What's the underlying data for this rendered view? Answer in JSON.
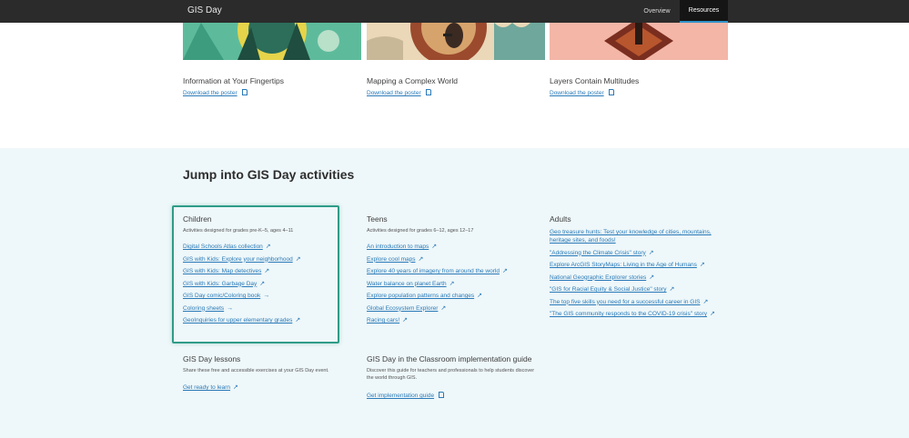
{
  "nav": {
    "brand": "GIS Day",
    "links": [
      "Overview",
      "Resources"
    ]
  },
  "posters": [
    {
      "title": "Information at Your Fingertips",
      "link": "Download the poster"
    },
    {
      "title": "Mapping a Complex World",
      "link": "Download the poster"
    },
    {
      "title": "Layers Contain Multitudes",
      "link": "Download the poster"
    }
  ],
  "activities": {
    "heading": "Jump into GIS Day activities",
    "children": {
      "title": "Children",
      "desc": "Activities designed for grades pre-K–5, ages 4–11",
      "links": [
        "Digital Schools Atlas collection",
        "GIS with Kids: Explore your neighborhood",
        "GIS with Kids: Map detectives",
        "GIS with Kids: Garbage Day",
        "GIS Day comic/Coloring book",
        "Coloring sheets",
        "GeoInquiries for upper elementary grades"
      ]
    },
    "teens": {
      "title": "Teens",
      "desc": "Activities designed for grades 6–12, ages 12–17",
      "links": [
        "An introduction to maps",
        "Explore cool maps",
        "Explore 40 years of imagery from around the world",
        "Water balance on planet Earth",
        "Explore population patterns and changes",
        "Global Ecosystem Explorer",
        "Racing cars!"
      ]
    },
    "adults": {
      "title": "Adults",
      "links": [
        "Geo treasure hunts: Test your knowledge of cities, mountains, heritage sites, and foods!",
        "\"Addressing the Climate Crisis\" story",
        "Explore ArcGIS StoryMaps: Living in the Age of Humans",
        "National Geographic Explorer stories",
        "\"GIS for Racial Equity & Social Justice\" story",
        "The top five skills you need for a successful career in GIS",
        "\"The GIS community responds to the COVID-19 crisis\" story"
      ]
    },
    "lessons": {
      "title": "GIS Day lessons",
      "desc": "Share these free and accessible exercises at your GIS Day event.",
      "link": "Get ready to learn"
    },
    "classroom": {
      "title": "GIS Day in the Classroom implementation guide",
      "desc": "Discover this guide for teachers and professionals to help students discover the world through GIS.",
      "link": "Get implementation guide"
    }
  },
  "colors": {
    "nav_bg": "#2b2b2b",
    "nav_active_border": "#2f92c9",
    "link": "#2a7ab8",
    "section_bg": "#eef7f9",
    "highlight_border": "#2f9c88"
  }
}
